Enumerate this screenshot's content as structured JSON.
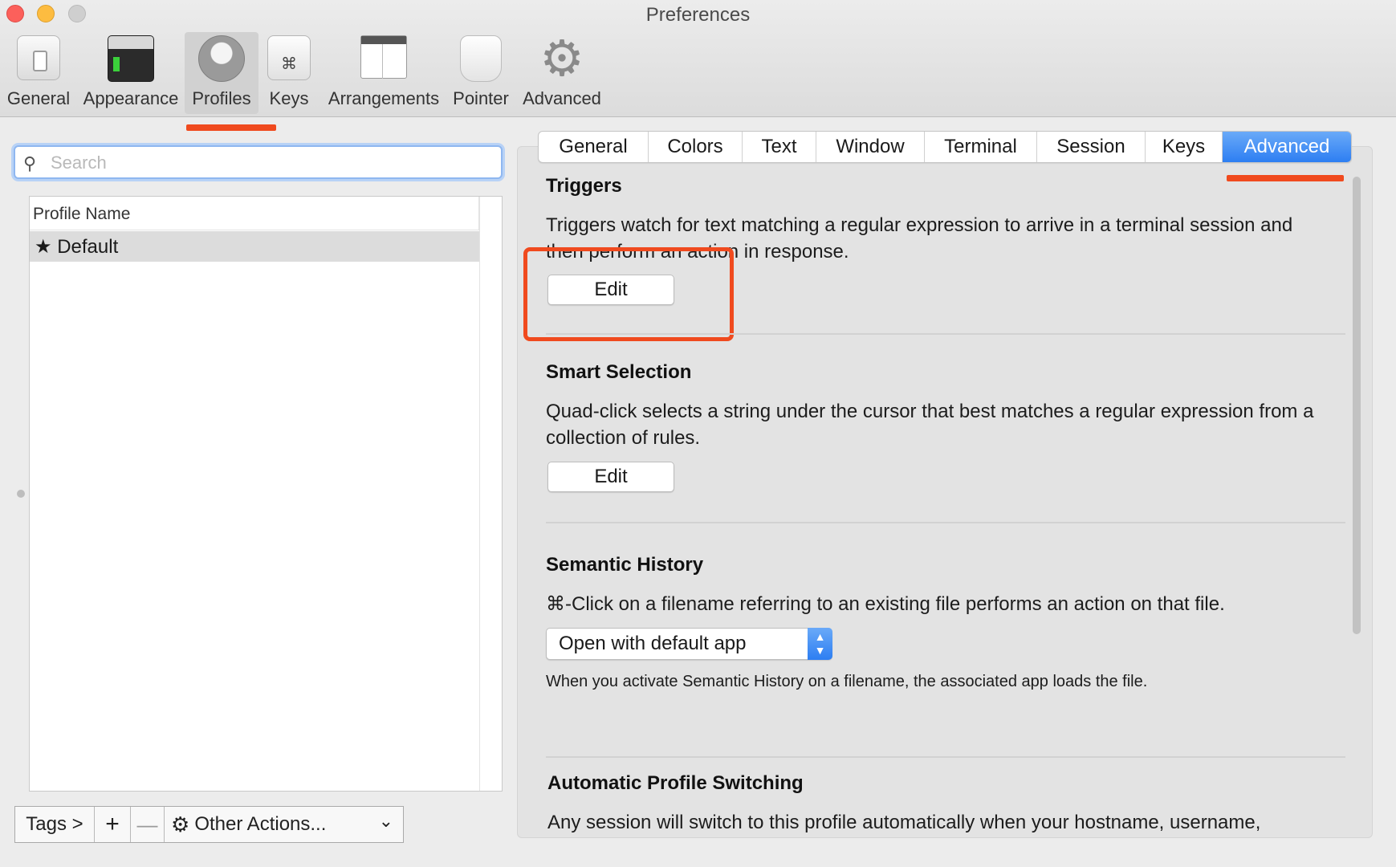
{
  "window": {
    "title": "Preferences"
  },
  "toolbar": {
    "items": [
      {
        "label": "General",
        "icon": "general-icon"
      },
      {
        "label": "Appearance",
        "icon": "appearance-icon"
      },
      {
        "label": "Profiles",
        "icon": "profiles-icon",
        "active": true
      },
      {
        "label": "Keys",
        "icon": "keys-icon"
      },
      {
        "label": "Arrangements",
        "icon": "arrangements-icon"
      },
      {
        "label": "Pointer",
        "icon": "pointer-icon"
      },
      {
        "label": "Advanced",
        "icon": "gear-icon"
      }
    ],
    "keys_glyph": "⌘"
  },
  "search": {
    "placeholder": "Search",
    "value": ""
  },
  "profiles": {
    "column_header": "Profile Name",
    "rows": [
      {
        "name": "Default",
        "default_marker": "★"
      }
    ]
  },
  "bottom_bar": {
    "tags": "Tags >",
    "add": "+",
    "remove": "—",
    "other_actions": "Other Actions...",
    "chevron": "⌄",
    "gear": "⚙"
  },
  "tabs": [
    "General",
    "Colors",
    "Text",
    "Window",
    "Terminal",
    "Session",
    "Keys",
    "Advanced"
  ],
  "active_tab": "Advanced",
  "sections": {
    "triggers": {
      "title": "Triggers",
      "description": "Triggers watch for text matching a regular expression to arrive in a terminal session and then perform an action in response.",
      "button": "Edit"
    },
    "smart_selection": {
      "title": "Smart Selection",
      "description": "Quad-click selects a string under the cursor that best matches a regular expression from a collection of rules.",
      "button": "Edit"
    },
    "semantic_history": {
      "title": "Semantic History",
      "description": "⌘-Click on a filename referring to an existing file performs an action on that file.",
      "select_value": "Open with default app",
      "note": "When you activate Semantic History on a filename, the associated app loads the file."
    },
    "automatic_profile_switching": {
      "title": "Automatic Profile Switching",
      "description": "Any session will switch to this profile automatically when your hostname, username,"
    }
  },
  "colors": {
    "accent": "#2d7ef2",
    "annotation_red": "#f04a1e"
  }
}
